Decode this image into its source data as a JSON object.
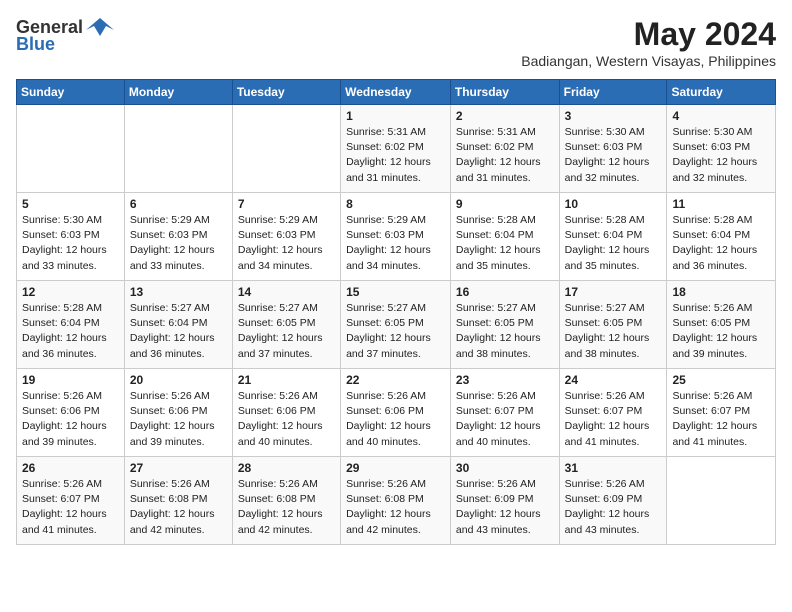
{
  "header": {
    "logo_general": "General",
    "logo_blue": "Blue",
    "title": "May 2024",
    "location": "Badiangan, Western Visayas, Philippines"
  },
  "calendar": {
    "days_of_week": [
      "Sunday",
      "Monday",
      "Tuesday",
      "Wednesday",
      "Thursday",
      "Friday",
      "Saturday"
    ],
    "weeks": [
      [
        {
          "num": "",
          "info": ""
        },
        {
          "num": "",
          "info": ""
        },
        {
          "num": "",
          "info": ""
        },
        {
          "num": "1",
          "info": "Sunrise: 5:31 AM\nSunset: 6:02 PM\nDaylight: 12 hours\nand 31 minutes."
        },
        {
          "num": "2",
          "info": "Sunrise: 5:31 AM\nSunset: 6:02 PM\nDaylight: 12 hours\nand 31 minutes."
        },
        {
          "num": "3",
          "info": "Sunrise: 5:30 AM\nSunset: 6:03 PM\nDaylight: 12 hours\nand 32 minutes."
        },
        {
          "num": "4",
          "info": "Sunrise: 5:30 AM\nSunset: 6:03 PM\nDaylight: 12 hours\nand 32 minutes."
        }
      ],
      [
        {
          "num": "5",
          "info": "Sunrise: 5:30 AM\nSunset: 6:03 PM\nDaylight: 12 hours\nand 33 minutes."
        },
        {
          "num": "6",
          "info": "Sunrise: 5:29 AM\nSunset: 6:03 PM\nDaylight: 12 hours\nand 33 minutes."
        },
        {
          "num": "7",
          "info": "Sunrise: 5:29 AM\nSunset: 6:03 PM\nDaylight: 12 hours\nand 34 minutes."
        },
        {
          "num": "8",
          "info": "Sunrise: 5:29 AM\nSunset: 6:03 PM\nDaylight: 12 hours\nand 34 minutes."
        },
        {
          "num": "9",
          "info": "Sunrise: 5:28 AM\nSunset: 6:04 PM\nDaylight: 12 hours\nand 35 minutes."
        },
        {
          "num": "10",
          "info": "Sunrise: 5:28 AM\nSunset: 6:04 PM\nDaylight: 12 hours\nand 35 minutes."
        },
        {
          "num": "11",
          "info": "Sunrise: 5:28 AM\nSunset: 6:04 PM\nDaylight: 12 hours\nand 36 minutes."
        }
      ],
      [
        {
          "num": "12",
          "info": "Sunrise: 5:28 AM\nSunset: 6:04 PM\nDaylight: 12 hours\nand 36 minutes."
        },
        {
          "num": "13",
          "info": "Sunrise: 5:27 AM\nSunset: 6:04 PM\nDaylight: 12 hours\nand 36 minutes."
        },
        {
          "num": "14",
          "info": "Sunrise: 5:27 AM\nSunset: 6:05 PM\nDaylight: 12 hours\nand 37 minutes."
        },
        {
          "num": "15",
          "info": "Sunrise: 5:27 AM\nSunset: 6:05 PM\nDaylight: 12 hours\nand 37 minutes."
        },
        {
          "num": "16",
          "info": "Sunrise: 5:27 AM\nSunset: 6:05 PM\nDaylight: 12 hours\nand 38 minutes."
        },
        {
          "num": "17",
          "info": "Sunrise: 5:27 AM\nSunset: 6:05 PM\nDaylight: 12 hours\nand 38 minutes."
        },
        {
          "num": "18",
          "info": "Sunrise: 5:26 AM\nSunset: 6:05 PM\nDaylight: 12 hours\nand 39 minutes."
        }
      ],
      [
        {
          "num": "19",
          "info": "Sunrise: 5:26 AM\nSunset: 6:06 PM\nDaylight: 12 hours\nand 39 minutes."
        },
        {
          "num": "20",
          "info": "Sunrise: 5:26 AM\nSunset: 6:06 PM\nDaylight: 12 hours\nand 39 minutes."
        },
        {
          "num": "21",
          "info": "Sunrise: 5:26 AM\nSunset: 6:06 PM\nDaylight: 12 hours\nand 40 minutes."
        },
        {
          "num": "22",
          "info": "Sunrise: 5:26 AM\nSunset: 6:06 PM\nDaylight: 12 hours\nand 40 minutes."
        },
        {
          "num": "23",
          "info": "Sunrise: 5:26 AM\nSunset: 6:07 PM\nDaylight: 12 hours\nand 40 minutes."
        },
        {
          "num": "24",
          "info": "Sunrise: 5:26 AM\nSunset: 6:07 PM\nDaylight: 12 hours\nand 41 minutes."
        },
        {
          "num": "25",
          "info": "Sunrise: 5:26 AM\nSunset: 6:07 PM\nDaylight: 12 hours\nand 41 minutes."
        }
      ],
      [
        {
          "num": "26",
          "info": "Sunrise: 5:26 AM\nSunset: 6:07 PM\nDaylight: 12 hours\nand 41 minutes."
        },
        {
          "num": "27",
          "info": "Sunrise: 5:26 AM\nSunset: 6:08 PM\nDaylight: 12 hours\nand 42 minutes."
        },
        {
          "num": "28",
          "info": "Sunrise: 5:26 AM\nSunset: 6:08 PM\nDaylight: 12 hours\nand 42 minutes."
        },
        {
          "num": "29",
          "info": "Sunrise: 5:26 AM\nSunset: 6:08 PM\nDaylight: 12 hours\nand 42 minutes."
        },
        {
          "num": "30",
          "info": "Sunrise: 5:26 AM\nSunset: 6:09 PM\nDaylight: 12 hours\nand 43 minutes."
        },
        {
          "num": "31",
          "info": "Sunrise: 5:26 AM\nSunset: 6:09 PM\nDaylight: 12 hours\nand 43 minutes."
        },
        {
          "num": "",
          "info": ""
        }
      ]
    ]
  }
}
